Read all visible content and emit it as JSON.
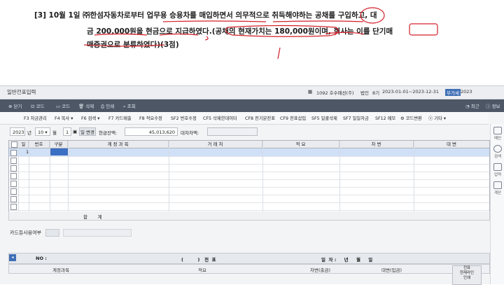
{
  "question": {
    "line1": "[3]  10월  1일  ㈜한섬자동차로부터  업무용  승용차를  매입하면서  의무적으로  취득해야하는  공채를  구입하고,  대",
    "line2": "금  200,000원을  현금으로  지급하였다.(공채의  현재가치는  180,000원이며,  회사는  이를  단기매",
    "line3": "매증권으로  분류하였다)(3점)"
  },
  "window": {
    "title": "일반전표입력",
    "company": "1092 호수패션(주)",
    "period_label": "법인",
    "period_num": "8기",
    "period_range": "2023-01-01~2023-12-31",
    "vat_label": "부가세",
    "vat_year": "2023"
  },
  "toolbar1": {
    "close": "닫기",
    "code": "코드",
    "code2": "코드",
    "delete": "삭제",
    "print": "인쇄",
    "search": "조회",
    "home": "홈",
    "help": "?",
    "right_a": "최근",
    "right_b": "정보"
  },
  "toolbar2": {
    "items": [
      "F3 자금관리",
      "F4 복사 ▾",
      "F6 검색 ▾",
      "F7 카드매출",
      "F8 적요수정",
      "SF2 번호수정",
      "CF5 삭제한데이터",
      "CF8 전기분전표",
      "CF9 전표삽입",
      "SF5 일괄삭제",
      "SF7 일일자금",
      "SF12 메모",
      "⚙ 코드변환",
      "ⓥ 기타 ▾"
    ]
  },
  "filter": {
    "year": "2023",
    "year_unit": "년",
    "month": "10",
    "month_unit": "월",
    "day": "1",
    "day_btn": "일 변경",
    "cash_label": "현금잔액:",
    "cash_value": "45,013,620",
    "diff_label": "대차차액:"
  },
  "grid": {
    "headers": [
      "일",
      "번호",
      "구분",
      "계 정 과 목",
      "거 래 처",
      "적 요",
      "차 변",
      "대 변"
    ],
    "first_row_day": "1",
    "total_label": "합       계"
  },
  "card": {
    "label": "카드등사용여부"
  },
  "bottom": {
    "no_label": "NO :",
    "voucher_label": "(         )   전  표",
    "date_label": "일  자 :     년     월     일",
    "cols": [
      "계정과목",
      "적요",
      "차변(출금)",
      "대변(입금)"
    ],
    "side_btn": "전표\n현재라인\n인쇄"
  },
  "rightbar": [
    "메인",
    "검색",
    "업적",
    "계산"
  ]
}
